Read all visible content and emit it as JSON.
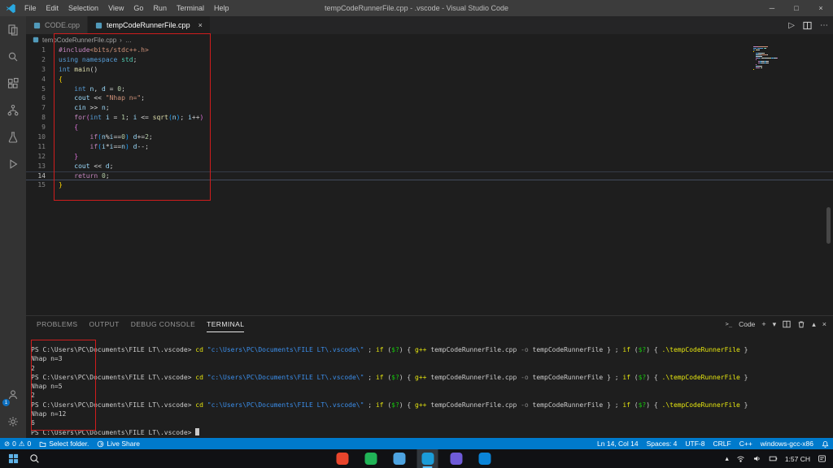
{
  "window": {
    "title": "tempCodeRunnerFile.cpp - .vscode - Visual Studio Code",
    "menus": [
      "File",
      "Edit",
      "Selection",
      "View",
      "Go",
      "Run",
      "Terminal",
      "Help"
    ]
  },
  "icons": {
    "minimize": "─",
    "maximize": "□",
    "close": "×",
    "run": "▷",
    "more": "⋯",
    "plus": "+",
    "chevron_down": "▾",
    "chevron_up": "▴",
    "breadcrumb_sep": "›",
    "errors": "⊘",
    "warnings": "⚠",
    "terminal_prompt_glyph": ">_",
    "tray_expand": "▴"
  },
  "activity_bar": {
    "items": [
      "explorer",
      "search",
      "extensions",
      "source-control",
      "testing",
      "run"
    ],
    "accounts_badge": "1"
  },
  "tabs": [
    {
      "label": "CODE.cpp",
      "active": false
    },
    {
      "label": "tempCodeRunnerFile.cpp",
      "active": true
    }
  ],
  "breadcrumb": {
    "file": "tempCodeRunnerFile.cpp",
    "more": "…"
  },
  "editor": {
    "active_line": 14,
    "lines": [
      {
        "n": 1,
        "tokens": [
          [
            "#include",
            "kwc"
          ],
          [
            "<bits/stdc++.h>",
            "str"
          ]
        ]
      },
      {
        "n": 2,
        "tokens": [
          [
            "using",
            "kw"
          ],
          [
            " ",
            "pln"
          ],
          [
            "namespace",
            "kw"
          ],
          [
            " ",
            "pln"
          ],
          [
            "std",
            "cls"
          ],
          [
            ";",
            "pln"
          ]
        ]
      },
      {
        "n": 3,
        "tokens": [
          [
            "int",
            "kw"
          ],
          [
            " ",
            "pln"
          ],
          [
            "main",
            "fn"
          ],
          [
            "()",
            "pln"
          ]
        ]
      },
      {
        "n": 4,
        "tokens": [
          [
            "{",
            "br1"
          ]
        ]
      },
      {
        "n": 5,
        "tokens": [
          [
            "    ",
            "pln"
          ],
          [
            "int",
            "kw"
          ],
          [
            " ",
            "pln"
          ],
          [
            "n",
            "var"
          ],
          [
            ", ",
            "pln"
          ],
          [
            "d",
            "var"
          ],
          [
            " = ",
            "pln"
          ],
          [
            "0",
            "num"
          ],
          [
            ";",
            "pln"
          ]
        ]
      },
      {
        "n": 6,
        "tokens": [
          [
            "    ",
            "pln"
          ],
          [
            "cout",
            "var"
          ],
          [
            " << ",
            "pln"
          ],
          [
            "\"Nhap n=\"",
            "str"
          ],
          [
            ";",
            "pln"
          ]
        ]
      },
      {
        "n": 7,
        "tokens": [
          [
            "    ",
            "pln"
          ],
          [
            "cin",
            "var"
          ],
          [
            " >> ",
            "pln"
          ],
          [
            "n",
            "var"
          ],
          [
            ";",
            "pln"
          ]
        ]
      },
      {
        "n": 8,
        "tokens": [
          [
            "    ",
            "pln"
          ],
          [
            "for",
            "kwc"
          ],
          [
            "(",
            "br2"
          ],
          [
            "int",
            "kw"
          ],
          [
            " ",
            "pln"
          ],
          [
            "i",
            "var"
          ],
          [
            " = ",
            "pln"
          ],
          [
            "1",
            "num"
          ],
          [
            "; ",
            "pln"
          ],
          [
            "i",
            "var"
          ],
          [
            " <= ",
            "pln"
          ],
          [
            "sqrt",
            "fn"
          ],
          [
            "(",
            "br3"
          ],
          [
            "n",
            "var"
          ],
          [
            ")",
            "br3"
          ],
          [
            "; ",
            "pln"
          ],
          [
            "i",
            "var"
          ],
          [
            "++",
            "pln"
          ],
          [
            ")",
            "br2"
          ]
        ]
      },
      {
        "n": 9,
        "tokens": [
          [
            "    ",
            "pln"
          ],
          [
            "{",
            "br2"
          ]
        ]
      },
      {
        "n": 10,
        "tokens": [
          [
            "        ",
            "pln"
          ],
          [
            "if",
            "kwc"
          ],
          [
            "(",
            "br3"
          ],
          [
            "n",
            "var"
          ],
          [
            "%",
            "pln"
          ],
          [
            "i",
            "var"
          ],
          [
            "==",
            "pln"
          ],
          [
            "0",
            "num"
          ],
          [
            ")",
            "br3"
          ],
          [
            " ",
            "pln"
          ],
          [
            "d",
            "var"
          ],
          [
            "+=",
            "pln"
          ],
          [
            "2",
            "num"
          ],
          [
            ";",
            "pln"
          ]
        ]
      },
      {
        "n": 11,
        "tokens": [
          [
            "        ",
            "pln"
          ],
          [
            "if",
            "kwc"
          ],
          [
            "(",
            "br3"
          ],
          [
            "i",
            "var"
          ],
          [
            "*",
            "pln"
          ],
          [
            "i",
            "var"
          ],
          [
            "==",
            "pln"
          ],
          [
            "n",
            "var"
          ],
          [
            ")",
            "br3"
          ],
          [
            " ",
            "pln"
          ],
          [
            "d",
            "var"
          ],
          [
            "--",
            "pln"
          ],
          [
            ";",
            "pln"
          ]
        ]
      },
      {
        "n": 12,
        "tokens": [
          [
            "    ",
            "pln"
          ],
          [
            "}",
            "br2"
          ]
        ]
      },
      {
        "n": 13,
        "tokens": [
          [
            "    ",
            "pln"
          ],
          [
            "cout",
            "var"
          ],
          [
            " << ",
            "pln"
          ],
          [
            "d",
            "var"
          ],
          [
            ";",
            "pln"
          ]
        ]
      },
      {
        "n": 14,
        "tokens": [
          [
            "    ",
            "pln"
          ],
          [
            "return",
            "kwc"
          ],
          [
            " ",
            "pln"
          ],
          [
            "0",
            "num"
          ],
          [
            ";",
            "pln"
          ]
        ]
      },
      {
        "n": 15,
        "tokens": [
          [
            "}",
            "br1"
          ]
        ]
      }
    ]
  },
  "panel": {
    "tabs": [
      "PROBLEMS",
      "OUTPUT",
      "DEBUG CONSOLE",
      "TERMINAL"
    ],
    "active_tab": "TERMINAL",
    "profile_label": "Code"
  },
  "terminal": {
    "prompt": "PS C:\\Users\\PC\\Documents\\FILE LT\\.vscode> ",
    "command_segments": [
      [
        "cd ",
        "y"
      ],
      [
        "\"c:\\Users\\PC\\Documents\\FILE LT\\.vscode\\\"",
        "b"
      ],
      [
        " ; ",
        "w"
      ],
      [
        "if",
        "y"
      ],
      [
        " (",
        "w"
      ],
      [
        "$?",
        "g"
      ],
      [
        ") { ",
        "w"
      ],
      [
        "g++",
        "y"
      ],
      [
        " tempCodeRunnerFile.cpp ",
        "w"
      ],
      [
        "-o",
        "gr"
      ],
      [
        " tempCodeRunnerFile } ; ",
        "w"
      ],
      [
        "if",
        "y"
      ],
      [
        " (",
        "w"
      ],
      [
        "$?",
        "g"
      ],
      [
        ") { ",
        "w"
      ],
      [
        ".\\tempCodeRunnerFile",
        "y"
      ],
      [
        " }",
        "w"
      ]
    ],
    "runs": [
      {
        "input": "Nhap n=3",
        "output": "2"
      },
      {
        "input": "Nhap n=5",
        "output": "2"
      },
      {
        "input": "Nhap n=12",
        "output": "6"
      }
    ]
  },
  "status_bar": {
    "errors": "0",
    "warnings": "0",
    "select_folder": "Select folder.",
    "live_share": "Live Share",
    "line_col": "Ln 14, Col 14",
    "spaces": "Spaces: 4",
    "encoding": "UTF-8",
    "eol": "CRLF",
    "language": "C++",
    "compiler": "windows-gcc-x86"
  },
  "taskbar": {
    "time": "1:57 CH",
    "apps": [
      {
        "name": "app-red",
        "color": "#e8452c",
        "active": false
      },
      {
        "name": "app-green",
        "color": "#21b457",
        "active": false
      },
      {
        "name": "file-explorer",
        "color": "#4da3e0",
        "active": false
      },
      {
        "name": "vscode",
        "color": "#1b9cd8",
        "active": true
      },
      {
        "name": "app-purple",
        "color": "#6f5bd8",
        "active": false
      },
      {
        "name": "zalo",
        "color": "#0a84d8",
        "active": false
      }
    ]
  }
}
